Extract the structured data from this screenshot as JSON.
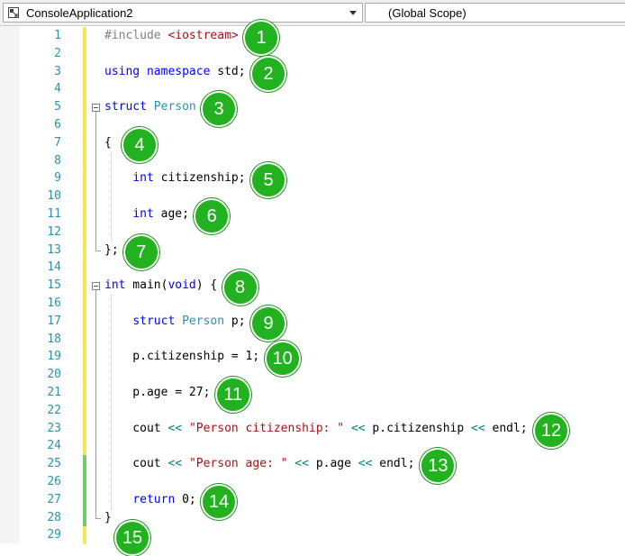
{
  "toolbar": {
    "project": "ConsoleApplication2",
    "scope": "(Global Scope)",
    "project_icon": "project-icon",
    "dropdown_icon": "chevron-down-icon"
  },
  "colors": {
    "keyword": "#0000ff",
    "type": "#2b91af",
    "string": "#a31515",
    "preprocessor": "#808080",
    "operator": "#008080",
    "line_number": "#2b91af",
    "badge": "#22b21f",
    "change_saved": "#6ccf6c",
    "change_unsaved": "#f3e65a"
  },
  "lines": [
    {
      "n": "1",
      "tokens": [
        {
          "t": "#include ",
          "c": "preprocessor"
        },
        {
          "t": "<iostream>",
          "c": "string"
        }
      ]
    },
    {
      "n": "2",
      "tokens": []
    },
    {
      "n": "3",
      "tokens": [
        {
          "t": "using",
          "c": "keyword"
        },
        {
          "t": " "
        },
        {
          "t": "namespace",
          "c": "keyword"
        },
        {
          "t": " std;"
        }
      ]
    },
    {
      "n": "4",
      "tokens": []
    },
    {
      "n": "5",
      "tokens": [
        {
          "t": "struct",
          "c": "keyword"
        },
        {
          "t": " "
        },
        {
          "t": "Person",
          "c": "type"
        }
      ]
    },
    {
      "n": "6",
      "tokens": []
    },
    {
      "n": "7",
      "tokens": [
        {
          "t": "{"
        }
      ]
    },
    {
      "n": "8",
      "tokens": []
    },
    {
      "n": "9",
      "tokens": [
        {
          "t": "    "
        },
        {
          "t": "int",
          "c": "keyword"
        },
        {
          "t": " citizenship;"
        }
      ]
    },
    {
      "n": "10",
      "tokens": []
    },
    {
      "n": "11",
      "tokens": [
        {
          "t": "    "
        },
        {
          "t": "int",
          "c": "keyword"
        },
        {
          "t": " age;"
        }
      ]
    },
    {
      "n": "12",
      "tokens": []
    },
    {
      "n": "13",
      "tokens": [
        {
          "t": "};"
        }
      ]
    },
    {
      "n": "14",
      "tokens": []
    },
    {
      "n": "15",
      "tokens": [
        {
          "t": "int",
          "c": "keyword"
        },
        {
          "t": " main("
        },
        {
          "t": "void",
          "c": "keyword"
        },
        {
          "t": ") {"
        }
      ]
    },
    {
      "n": "16",
      "tokens": []
    },
    {
      "n": "17",
      "tokens": [
        {
          "t": "    "
        },
        {
          "t": "struct",
          "c": "keyword"
        },
        {
          "t": " "
        },
        {
          "t": "Person",
          "c": "type"
        },
        {
          "t": " p;"
        }
      ]
    },
    {
      "n": "18",
      "tokens": []
    },
    {
      "n": "19",
      "tokens": [
        {
          "t": "    p.citizenship = 1;"
        }
      ]
    },
    {
      "n": "20",
      "tokens": []
    },
    {
      "n": "21",
      "tokens": [
        {
          "t": "    p.age = 27;"
        }
      ]
    },
    {
      "n": "22",
      "tokens": []
    },
    {
      "n": "23",
      "tokens": [
        {
          "t": "    cout "
        },
        {
          "t": "<<",
          "c": "operator"
        },
        {
          "t": " "
        },
        {
          "t": "\"Person citizenship: \"",
          "c": "string"
        },
        {
          "t": " "
        },
        {
          "t": "<<",
          "c": "operator"
        },
        {
          "t": " p.citizenship "
        },
        {
          "t": "<<",
          "c": "operator"
        },
        {
          "t": " endl;"
        }
      ]
    },
    {
      "n": "24",
      "tokens": []
    },
    {
      "n": "25",
      "tokens": [
        {
          "t": "    cout "
        },
        {
          "t": "<<",
          "c": "operator"
        },
        {
          "t": " "
        },
        {
          "t": "\"Person age: \"",
          "c": "string"
        },
        {
          "t": " "
        },
        {
          "t": "<<",
          "c": "operator"
        },
        {
          "t": " p.age "
        },
        {
          "t": "<<",
          "c": "operator"
        },
        {
          "t": " endl;"
        }
      ]
    },
    {
      "n": "26",
      "tokens": []
    },
    {
      "n": "27",
      "tokens": [
        {
          "t": "    "
        },
        {
          "t": "return",
          "c": "keyword"
        },
        {
          "t": " 0;"
        }
      ]
    },
    {
      "n": "28",
      "tokens": [
        {
          "t": "}"
        }
      ]
    },
    {
      "n": "29",
      "tokens": []
    }
  ],
  "badges": [
    "1",
    "2",
    "3",
    "4",
    "5",
    "6",
    "7",
    "8",
    "9",
    "10",
    "11",
    "12",
    "13",
    "14",
    "15"
  ]
}
